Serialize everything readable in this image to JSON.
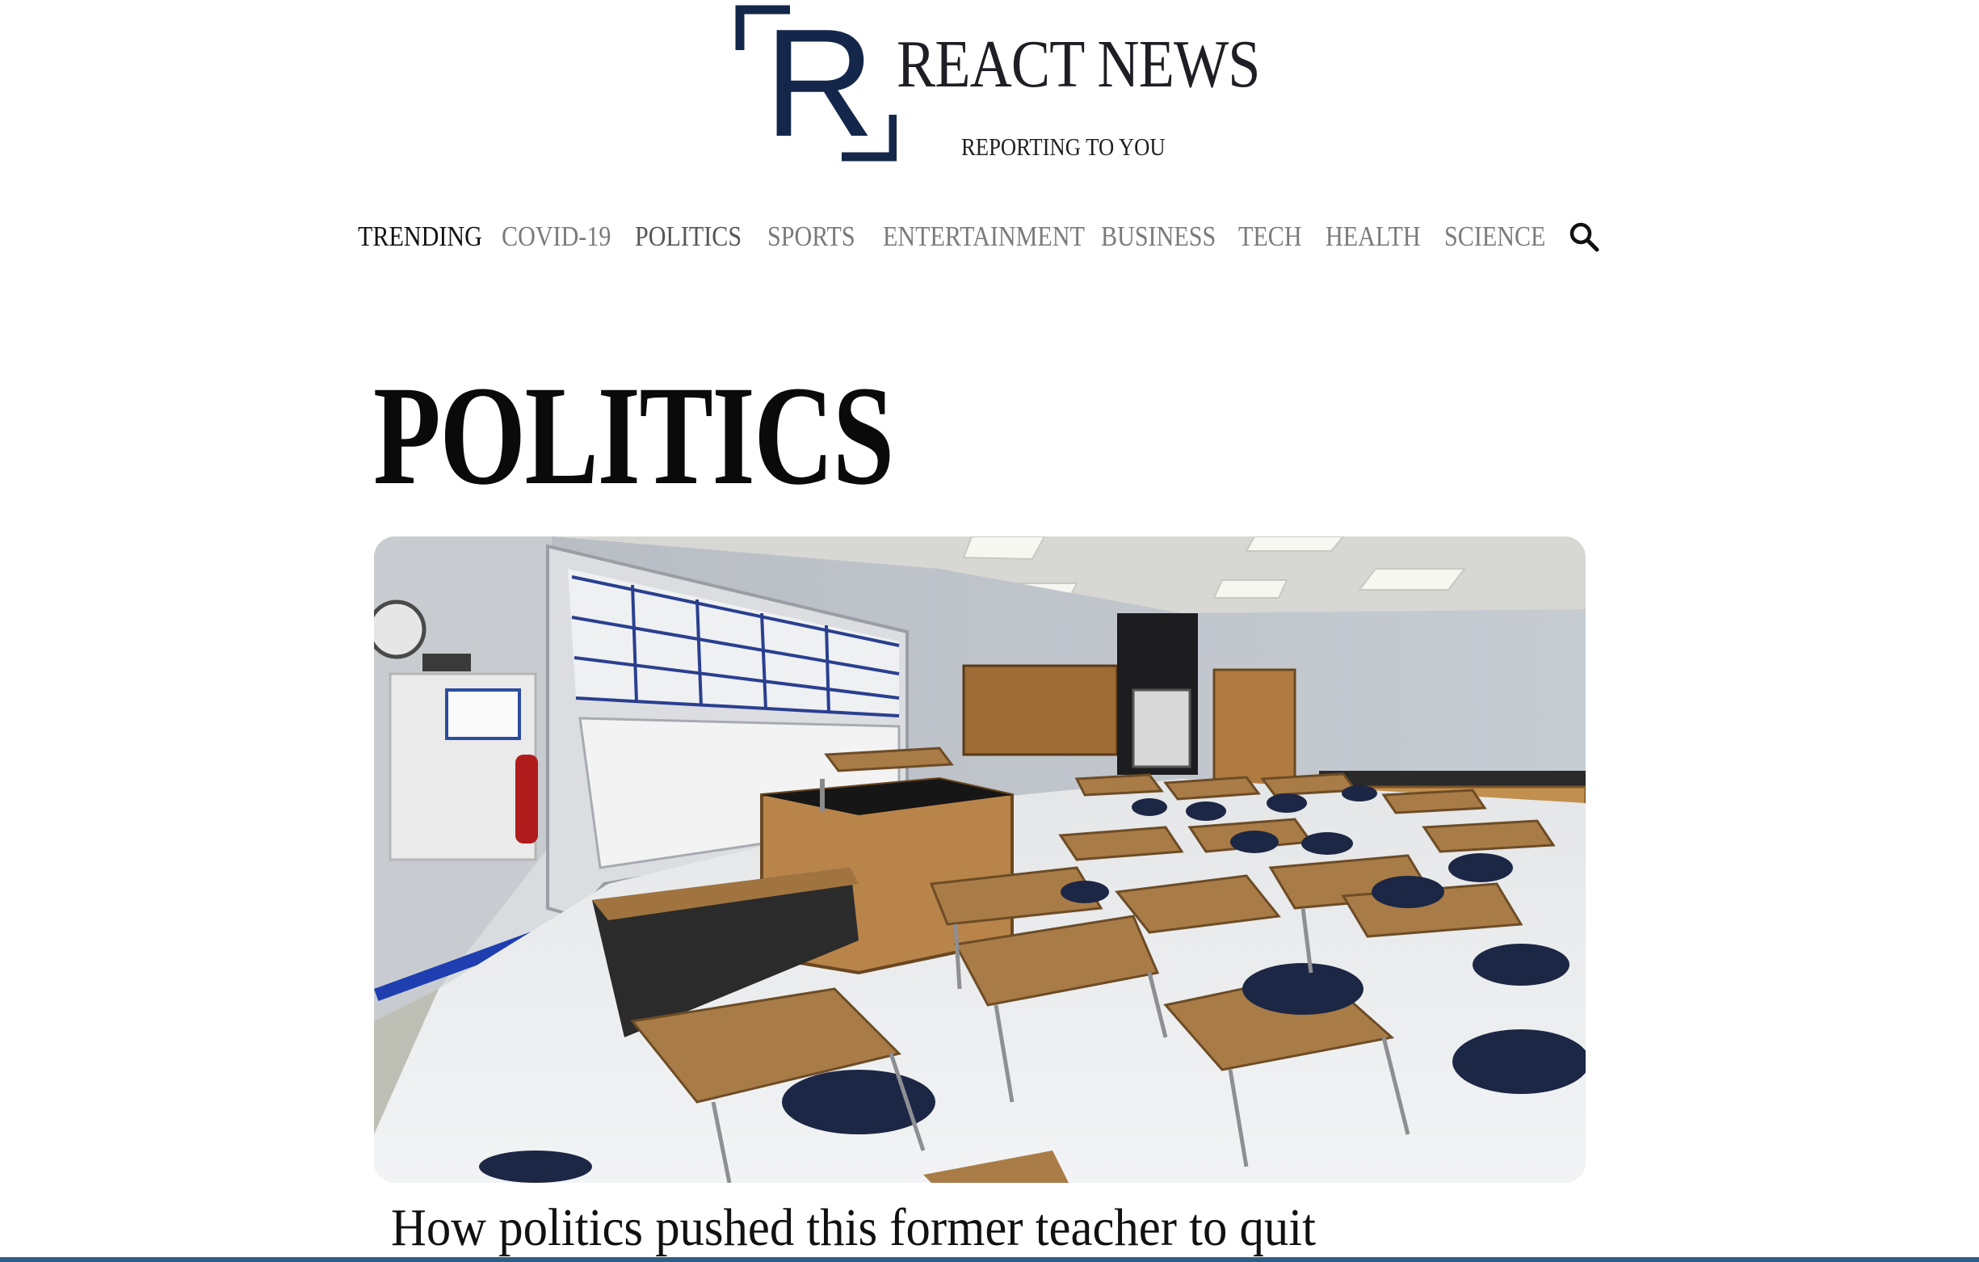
{
  "brand": {
    "logo_letter": "R",
    "name": "REACT NEWS",
    "tagline": "REPORTING TO YOU",
    "color": "#14264a"
  },
  "nav": {
    "items": [
      {
        "label": "TRENDING",
        "state": "active"
      },
      {
        "label": "COVID-19",
        "state": "inactive"
      },
      {
        "label": "POLITICS",
        "state": "current"
      },
      {
        "label": "SPORTS",
        "state": "inactive"
      },
      {
        "label": "ENTERTAINMENT",
        "state": "inactive"
      },
      {
        "label": "BUSINESS",
        "state": "inactive"
      },
      {
        "label": "TECH",
        "state": "inactive"
      },
      {
        "label": "HEALTH",
        "state": "inactive"
      },
      {
        "label": "SCIENCE",
        "state": "inactive"
      }
    ],
    "search_icon": "search-icon"
  },
  "page": {
    "title": "POLITICS"
  },
  "article": {
    "image_subject": "empty classroom",
    "headline": "How politics pushed this former teacher to quit"
  }
}
